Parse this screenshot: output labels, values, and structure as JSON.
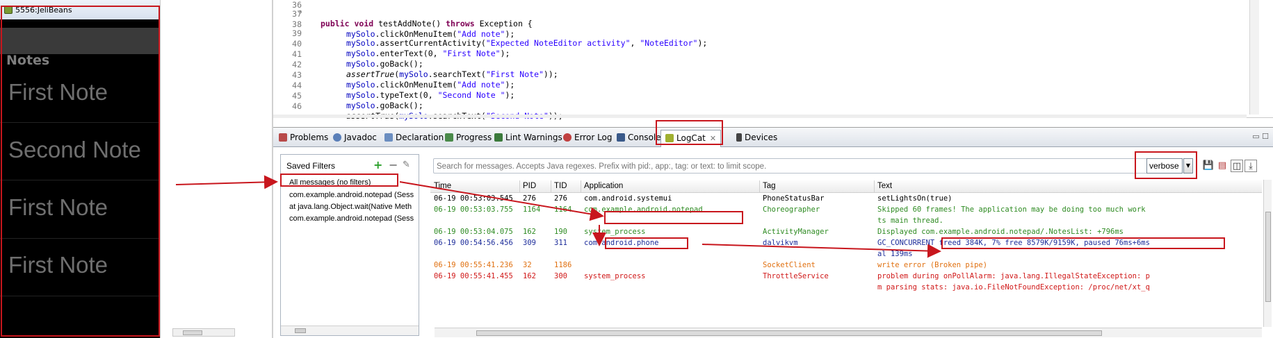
{
  "emulator": {
    "title": "5556:JeliBeans",
    "app_title": "Notes",
    "notes": [
      "First Note",
      "Second Note",
      "First Note",
      "First Note"
    ]
  },
  "editor": {
    "lines": [
      {
        "n": "36"
      },
      {
        "n": "37"
      },
      {
        "n": "38"
      },
      {
        "n": "39"
      },
      {
        "n": "40"
      },
      {
        "n": "41"
      },
      {
        "n": "42"
      },
      {
        "n": "43"
      },
      {
        "n": "44"
      },
      {
        "n": "45"
      },
      {
        "n": "46"
      }
    ],
    "code": {
      "l37": {
        "k1": "public",
        "k2": "void",
        "name": "testAddNote()",
        "k3": "throws",
        "rest": "Exception {"
      },
      "l38": {
        "obj": "mySolo",
        "call": ".clickOnMenuItem(",
        "arg": "\"Add note\"",
        "end": ");"
      },
      "l39": {
        "obj": "mySolo",
        "call": ".assertCurrentActivity(",
        "arg": "\"Expected NoteEditor activity\"",
        "mid": ", ",
        "arg2": "\"NoteEditor\"",
        "end": ");"
      },
      "l40": {
        "obj": "mySolo",
        "call": ".enterText(0, ",
        "arg": "\"First Note\"",
        "end": ");"
      },
      "l41": {
        "obj": "mySolo",
        "call": ".goBack();"
      },
      "l42": {
        "fn": "assertTrue",
        "open": "(",
        "obj": "mySolo",
        "call": ".searchText(",
        "arg": "\"First Note\"",
        "end": "));"
      },
      "l43": {
        "obj": "mySolo",
        "call": ".clickOnMenuItem(",
        "arg": "\"Add note\"",
        "end": ");"
      },
      "l44": {
        "obj": "mySolo",
        "call": ".typeText(0, ",
        "arg": "\"Second Note \"",
        "end": ");"
      },
      "l45": {
        "obj": "mySolo",
        "call": ".goBack();"
      },
      "l46": {
        "fn": "assertTrue",
        "open": "(",
        "obj": "mySolo",
        "call": ".searchText(",
        "arg": "\"Second Note\"",
        "end": "));"
      }
    }
  },
  "tabs": [
    {
      "label": "Problems",
      "icon": "problems-icon",
      "color": "#b84a4a"
    },
    {
      "label": "Javadoc",
      "icon": "javadoc-icon",
      "color": "#5a7fb8"
    },
    {
      "label": "Declaration",
      "icon": "declaration-icon",
      "color": "#6b8ec0"
    },
    {
      "label": "Progress",
      "icon": "progress-icon",
      "color": "#4a8a4a"
    },
    {
      "label": "Lint Warnings",
      "icon": "lint-icon",
      "color": "#3b7a3b"
    },
    {
      "label": "Error Log",
      "icon": "error-log-icon",
      "color": "#c04040"
    },
    {
      "label": "Console",
      "icon": "console-icon",
      "color": "#3a5a8a"
    },
    {
      "label": "LogCat",
      "icon": "logcat-icon",
      "color": "#a0b030",
      "active": true
    },
    {
      "label": "Devices",
      "icon": "devices-icon",
      "color": "#444444"
    }
  ],
  "filters": {
    "title": "Saved Filters",
    "items": [
      "All messages (no filters)",
      "com.example.android.notepad (Sess",
      "at java.lang.Object.wait(Native Meth",
      "com.example.android.notepad (Sess"
    ]
  },
  "search": {
    "placeholder": "Search for messages. Accepts Java regexes. Prefix with pid:, app:, tag: or text: to limit scope."
  },
  "level": {
    "selected": "verbose"
  },
  "log": {
    "headers": {
      "time": "Time",
      "pid": "PID",
      "tid": "TID",
      "app": "Application",
      "tag": "Tag",
      "text": "Text"
    },
    "rows": [
      {
        "time": "06-19 00:53:03.545",
        "pid": "276",
        "tid": "276",
        "app": "com.android.systemui",
        "tag": "PhoneStatusBar",
        "text": "setLightsOn(true)",
        "color": "#000000"
      },
      {
        "time": "06-19 00:53:03.755",
        "pid": "1164",
        "tid": "1164",
        "app": "com.example.android.notepad",
        "tag": "Choreographer",
        "text": "Skipped 60 frames!  The application may be doing too much work",
        "color": "#2e8b22"
      },
      {
        "time": "",
        "pid": "",
        "tid": "",
        "app": "",
        "tag": "",
        "text": "ts main thread.",
        "color": "#2e8b22"
      },
      {
        "time": "06-19 00:53:04.075",
        "pid": "162",
        "tid": "190",
        "app": "system_process",
        "tag": "ActivityManager",
        "text": "Displayed com.example.android.notepad/.NotesList: +796ms",
        "color": "#2e8b22"
      },
      {
        "time": "06-19 00:54:56.456",
        "pid": "309",
        "tid": "311",
        "app": "com.android.phone",
        "tag": "dalvikvm",
        "text": "GC_CONCURRENT freed 384K, 7% free 8579K/9159K, paused 76ms+6ms",
        "color": "#1c2c9a"
      },
      {
        "time": "",
        "pid": "",
        "tid": "",
        "app": "",
        "tag": "",
        "text": "al 139ms",
        "color": "#1c2c9a"
      },
      {
        "time": "06-19 00:55:41.236",
        "pid": "32",
        "tid": "1186",
        "app": "",
        "tag": "SocketClient",
        "text": "write error (Broken pipe)",
        "color": "#e07010"
      },
      {
        "time": "06-19 00:55:41.455",
        "pid": "162",
        "tid": "300",
        "app": "system_process",
        "tag": "ThrottleService",
        "text": "problem during onPollAlarm: java.lang.IllegalStateException: p",
        "color": "#d01818"
      },
      {
        "time": "",
        "pid": "",
        "tid": "",
        "app": "",
        "tag": "",
        "text": "m parsing stats: java.io.FileNotFoundException: /proc/net/xt_q",
        "color": "#d01818"
      }
    ]
  },
  "colors": {
    "annotation": "#c8161d",
    "keyword": "#7f0055",
    "field": "#0000c0",
    "string": "#2a00ff"
  }
}
